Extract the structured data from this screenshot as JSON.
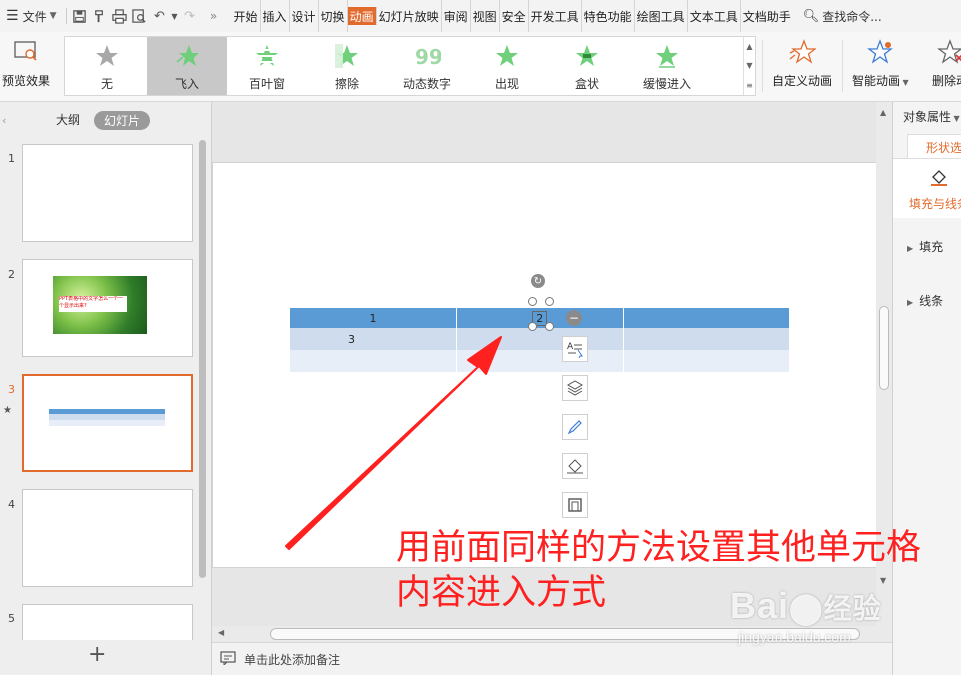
{
  "menubar": {
    "file_label": "文件",
    "more_label": "»",
    "tabs": [
      "开始",
      "插入",
      "设计",
      "切换",
      "动画",
      "幻灯片放映",
      "审阅",
      "视图",
      "安全",
      "开发工具",
      "特色功能",
      "绘图工具",
      "文本工具",
      "文档助手"
    ],
    "active_tab": "动画",
    "search_label": "查找命令..."
  },
  "ribbon": {
    "preview_label": "预览效果",
    "animations": [
      {
        "label": "无"
      },
      {
        "label": "飞入"
      },
      {
        "label": "百叶窗"
      },
      {
        "label": "擦除"
      },
      {
        "label": "动态数字"
      },
      {
        "label": "出现"
      },
      {
        "label": "盒状"
      },
      {
        "label": "缓慢进入"
      }
    ],
    "selected_animation": "飞入",
    "custom_animation_label": "自定义动画",
    "smart_animation_label": "智能动画",
    "delete_label": "删除动"
  },
  "leftpane": {
    "tab_outline": "大纲",
    "tab_slides": "幻灯片",
    "slide_numbers": [
      "1",
      "2",
      "3",
      "4",
      "5"
    ],
    "slide2_thumb_text": "PPT表格中的文字怎么一个一个显示出来?",
    "current_slide": "3",
    "add_label": "+"
  },
  "slide": {
    "table": {
      "row1": [
        "1",
        "2",
        ""
      ],
      "row2": [
        "3",
        "",
        ""
      ],
      "row3": [
        "",
        "",
        ""
      ]
    }
  },
  "notes": {
    "placeholder": "单击此处添加备注"
  },
  "rightpane": {
    "title": "对象属性",
    "tab_label": "形状选项",
    "fill_line_label": "填充与线条",
    "section_fill": "填充",
    "section_line": "线条"
  },
  "annotation": {
    "line1": "用前面同样的方法设置其他单元格",
    "line2": "内容进入方式"
  },
  "watermark": {
    "main": "Bai",
    "main2": "经验",
    "sub": "jingyan.baidu.com"
  },
  "colors": {
    "accent": "#e26a2c",
    "table_header": "#5b9bd5",
    "annotation_red": "#ff2020",
    "star_green": "#6fcf7a"
  }
}
